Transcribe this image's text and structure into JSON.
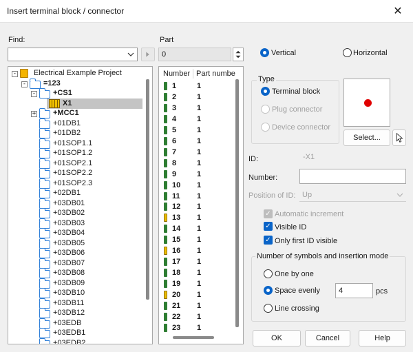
{
  "window": {
    "title": "Insert terminal block / connector"
  },
  "find": {
    "label": "Find:",
    "value": ""
  },
  "part": {
    "label": "Part",
    "value": "0"
  },
  "tree": {
    "items": [
      {
        "label": "Electrical Example Project",
        "kind": "project",
        "bold": false,
        "expander": "-"
      },
      {
        "label": "=123",
        "kind": "open-folder",
        "bold": true,
        "expander": "-"
      },
      {
        "label": "+CS1",
        "kind": "open-folder",
        "bold": true,
        "expander": "-"
      },
      {
        "label": "X1",
        "kind": "terminal",
        "bold": true,
        "expander": "",
        "selected": true
      },
      {
        "label": "+MCC1",
        "kind": "folder",
        "bold": true,
        "expander": "+"
      },
      {
        "label": "+01DB1",
        "kind": "folder",
        "bold": false,
        "expander": ""
      },
      {
        "label": "+01DB2",
        "kind": "folder",
        "bold": false,
        "expander": ""
      },
      {
        "label": "+01SOP1.1",
        "kind": "folder",
        "bold": false,
        "expander": ""
      },
      {
        "label": "+01SOP1.2",
        "kind": "folder",
        "bold": false,
        "expander": ""
      },
      {
        "label": "+01SOP2.1",
        "kind": "folder",
        "bold": false,
        "expander": ""
      },
      {
        "label": "+01SOP2.2",
        "kind": "folder",
        "bold": false,
        "expander": ""
      },
      {
        "label": "+01SOP2.3",
        "kind": "folder",
        "bold": false,
        "expander": ""
      },
      {
        "label": "+02DB1",
        "kind": "folder",
        "bold": false,
        "expander": ""
      },
      {
        "label": "+03DB01",
        "kind": "folder",
        "bold": false,
        "expander": ""
      },
      {
        "label": "+03DB02",
        "kind": "folder",
        "bold": false,
        "expander": ""
      },
      {
        "label": "+03DB03",
        "kind": "folder",
        "bold": false,
        "expander": ""
      },
      {
        "label": "+03DB04",
        "kind": "folder",
        "bold": false,
        "expander": ""
      },
      {
        "label": "+03DB05",
        "kind": "folder",
        "bold": false,
        "expander": ""
      },
      {
        "label": "+03DB06",
        "kind": "folder",
        "bold": false,
        "expander": ""
      },
      {
        "label": "+03DB07",
        "kind": "folder",
        "bold": false,
        "expander": ""
      },
      {
        "label": "+03DB08",
        "kind": "folder",
        "bold": false,
        "expander": ""
      },
      {
        "label": "+03DB09",
        "kind": "folder",
        "bold": false,
        "expander": ""
      },
      {
        "label": "+03DB10",
        "kind": "folder",
        "bold": false,
        "expander": ""
      },
      {
        "label": "+03DB11",
        "kind": "folder",
        "bold": false,
        "expander": ""
      },
      {
        "label": "+03DB12",
        "kind": "folder",
        "bold": false,
        "expander": ""
      },
      {
        "label": "+03EDB",
        "kind": "folder",
        "bold": false,
        "expander": ""
      },
      {
        "label": "+03EDB1",
        "kind": "folder",
        "bold": false,
        "expander": ""
      },
      {
        "label": "+03EDB2",
        "kind": "folder",
        "bold": false,
        "expander": ""
      }
    ]
  },
  "partlist": {
    "headers": [
      "Number",
      "Part numbe"
    ],
    "rows": [
      {
        "number": "1",
        "part": "1",
        "icon": "green"
      },
      {
        "number": "2",
        "part": "1",
        "icon": "green"
      },
      {
        "number": "3",
        "part": "1",
        "icon": "green"
      },
      {
        "number": "4",
        "part": "1",
        "icon": "green"
      },
      {
        "number": "5",
        "part": "1",
        "icon": "green"
      },
      {
        "number": "6",
        "part": "1",
        "icon": "green"
      },
      {
        "number": "7",
        "part": "1",
        "icon": "green"
      },
      {
        "number": "8",
        "part": "1",
        "icon": "green"
      },
      {
        "number": "9",
        "part": "1",
        "icon": "green"
      },
      {
        "number": "10",
        "part": "1",
        "icon": "green"
      },
      {
        "number": "11",
        "part": "1",
        "icon": "green"
      },
      {
        "number": "12",
        "part": "1",
        "icon": "green"
      },
      {
        "number": "13",
        "part": "1",
        "icon": "yellow"
      },
      {
        "number": "14",
        "part": "1",
        "icon": "green"
      },
      {
        "number": "15",
        "part": "1",
        "icon": "green"
      },
      {
        "number": "16",
        "part": "1",
        "icon": "yellow"
      },
      {
        "number": "17",
        "part": "1",
        "icon": "green"
      },
      {
        "number": "18",
        "part": "1",
        "icon": "green"
      },
      {
        "number": "19",
        "part": "1",
        "icon": "green"
      },
      {
        "number": "20",
        "part": "1",
        "icon": "yellow"
      },
      {
        "number": "21",
        "part": "1",
        "icon": "green"
      },
      {
        "number": "22",
        "part": "1",
        "icon": "green"
      },
      {
        "number": "23",
        "part": "1",
        "icon": "green"
      }
    ]
  },
  "orientation": {
    "vertical": "Vertical",
    "horizontal": "Horizontal"
  },
  "type": {
    "title": "Type",
    "terminal_block": "Terminal block",
    "plug_connector": "Plug connector",
    "device_connector": "Device connector"
  },
  "select_button": "Select...",
  "id": {
    "label": "ID:",
    "value": "-X1"
  },
  "number": {
    "label": "Number:",
    "value": ""
  },
  "position_of_id": {
    "label": "Position of ID:",
    "value": "Up"
  },
  "checks": {
    "automatic_increment": "Automatic increment",
    "visible_id": "Visible ID",
    "only_first_id_visible": "Only first ID visible"
  },
  "mode": {
    "title": "Number of symbols and insertion mode",
    "one_by_one": "One by one",
    "space_evenly": "Space evenly",
    "count": "4",
    "unit": "pcs",
    "line_crossing": "Line crossing"
  },
  "buttons": {
    "ok": "OK",
    "cancel": "Cancel",
    "help": "Help"
  },
  "colors": {
    "accent": "#0a64c8",
    "preview_dot": "#e00000",
    "selection": "#c4c4c4"
  }
}
